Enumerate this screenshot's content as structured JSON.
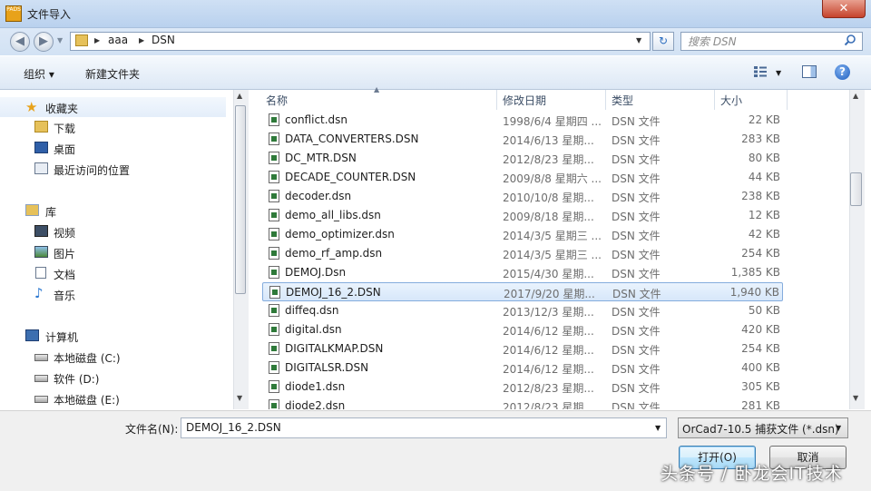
{
  "window": {
    "title": "文件导入",
    "app_icon_text": "PADS",
    "close_glyph": "✕"
  },
  "address": {
    "crumbs": [
      "aaa",
      "DSN"
    ],
    "search_placeholder": "搜索 DSN"
  },
  "toolbar": {
    "organize": "组织 ▾",
    "new_folder": "新建文件夹"
  },
  "nav": {
    "favorites": {
      "label": "收藏夹",
      "items": [
        "下载",
        "桌面",
        "最近访问的位置"
      ]
    },
    "libraries": {
      "label": "库",
      "items": [
        "视频",
        "图片",
        "文档",
        "音乐"
      ]
    },
    "computer": {
      "label": "计算机",
      "items": [
        "本地磁盘 (C:)",
        "软件 (D:)",
        "本地磁盘 (E:)"
      ]
    }
  },
  "columns": {
    "name": "名称",
    "date": "修改日期",
    "type": "类型",
    "size": "大小"
  },
  "files": [
    {
      "name": "conflict.dsn",
      "date": "1998/6/4 星期四 ...",
      "type": "DSN 文件",
      "size": "22 KB"
    },
    {
      "name": "DATA_CONVERTERS.DSN",
      "date": "2014/6/13 星期...",
      "type": "DSN 文件",
      "size": "283 KB"
    },
    {
      "name": "DC_MTR.DSN",
      "date": "2012/8/23 星期...",
      "type": "DSN 文件",
      "size": "80 KB"
    },
    {
      "name": "DECADE_COUNTER.DSN",
      "date": "2009/8/8 星期六 ...",
      "type": "DSN 文件",
      "size": "44 KB"
    },
    {
      "name": "decoder.dsn",
      "date": "2010/10/8 星期...",
      "type": "DSN 文件",
      "size": "238 KB"
    },
    {
      "name": "demo_all_libs.dsn",
      "date": "2009/8/18 星期...",
      "type": "DSN 文件",
      "size": "12 KB"
    },
    {
      "name": "demo_optimizer.dsn",
      "date": "2014/3/5 星期三 ...",
      "type": "DSN 文件",
      "size": "42 KB"
    },
    {
      "name": "demo_rf_amp.dsn",
      "date": "2014/3/5 星期三 ...",
      "type": "DSN 文件",
      "size": "254 KB"
    },
    {
      "name": "DEMOJ.Dsn",
      "date": "2015/4/30 星期...",
      "type": "DSN 文件",
      "size": "1,385 KB"
    },
    {
      "name": "DEMOJ_16_2.DSN",
      "date": "2017/9/20 星期...",
      "type": "DSN 文件",
      "size": "1,940 KB",
      "selected": true
    },
    {
      "name": "diffeq.dsn",
      "date": "2013/12/3 星期...",
      "type": "DSN 文件",
      "size": "50 KB"
    },
    {
      "name": "digital.dsn",
      "date": "2014/6/12 星期...",
      "type": "DSN 文件",
      "size": "420 KB"
    },
    {
      "name": "DIGITALKMAP.DSN",
      "date": "2014/6/12 星期...",
      "type": "DSN 文件",
      "size": "254 KB"
    },
    {
      "name": "DIGITALSR.DSN",
      "date": "2014/6/12 星期...",
      "type": "DSN 文件",
      "size": "400 KB"
    },
    {
      "name": "diode1.dsn",
      "date": "2012/8/23 星期...",
      "type": "DSN 文件",
      "size": "305 KB"
    },
    {
      "name": "diode2.dsn",
      "date": "2012/8/23 星期...",
      "type": "DSN 文件",
      "size": "281 KB"
    }
  ],
  "bottom": {
    "filename_label": "文件名(N):",
    "filename_value": "DEMOJ_16_2.DSN",
    "filetype_value": "OrCad7-10.5 捕获文件 (*.dsn)",
    "open": "打开(O)",
    "cancel": "取消"
  },
  "watermark": "头条号 / 卧龙会IT技术"
}
